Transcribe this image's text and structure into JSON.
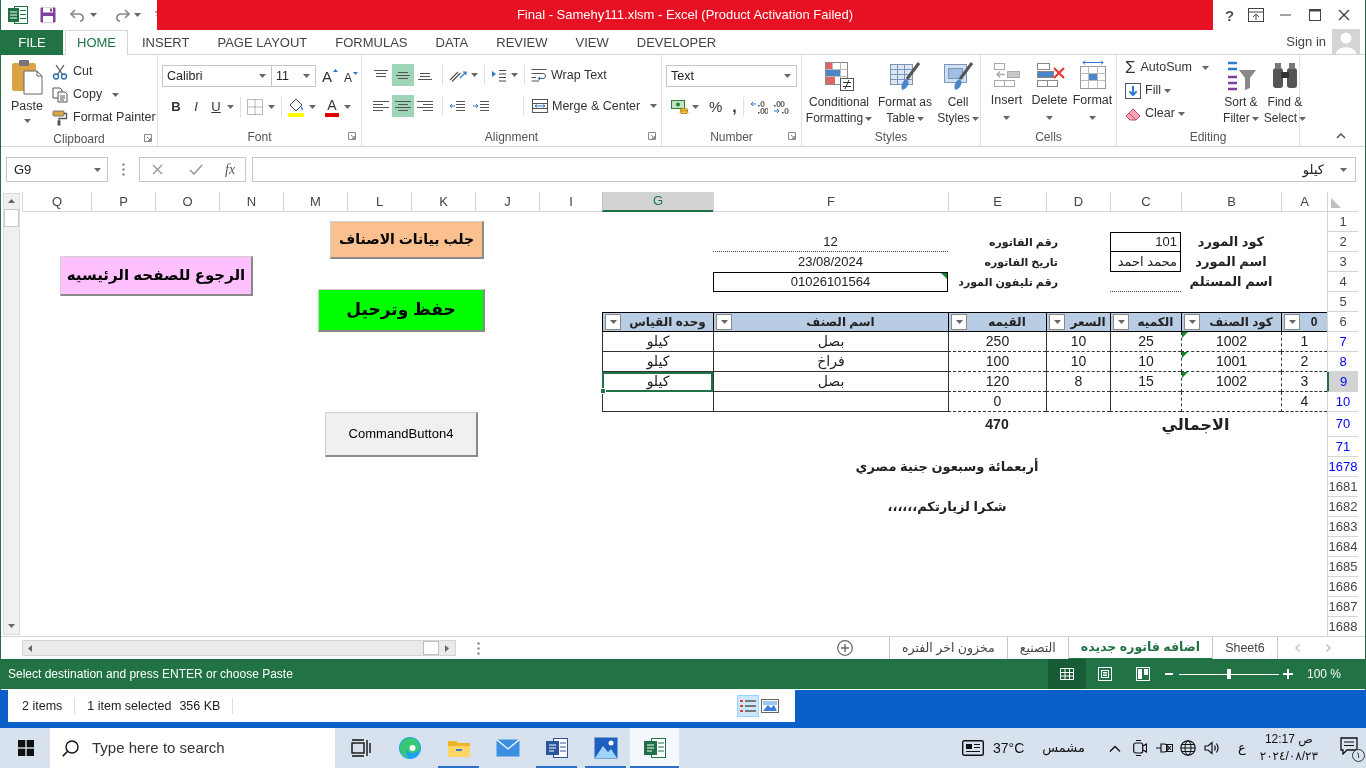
{
  "title_bar": {
    "title": "Final - Samehy111.xlsm - Excel (Product Activation Failed)",
    "help": "?"
  },
  "ribbon_tabs": {
    "file": {
      "label": "FILE",
      "kind": "file",
      "selected": false
    },
    "home": {
      "label": "HOME",
      "kind": "tab",
      "selected": true
    },
    "insert": {
      "label": "INSERT",
      "kind": "tab",
      "selected": false
    },
    "page_layout": {
      "label": "PAGE LAYOUT",
      "kind": "tab",
      "selected": false
    },
    "formulas": {
      "label": "FORMULAS",
      "kind": "tab",
      "selected": false
    },
    "data": {
      "label": "DATA",
      "kind": "tab",
      "selected": false
    },
    "review": {
      "label": "REVIEW",
      "kind": "tab",
      "selected": false
    },
    "view": {
      "label": "VIEW",
      "kind": "tab",
      "selected": false
    },
    "developer": {
      "label": "DEVELOPER",
      "kind": "tab",
      "selected": false
    }
  },
  "account": {
    "label": "Sign in"
  },
  "ribbon": {
    "clipboard": {
      "label": "Clipboard",
      "paste": "Paste",
      "cut": "Cut",
      "copy": "Copy",
      "format_painter": "Format Painter"
    },
    "font": {
      "label": "Font",
      "name": "Calibri",
      "size": "11",
      "grow": "A",
      "shrink": "A",
      "bold": "B",
      "italic": "I",
      "underline": "U",
      "font_color": "A"
    },
    "alignment": {
      "label": "Alignment",
      "vertical": [
        {
          "kind": "top",
          "selected": false
        },
        {
          "kind": "middle",
          "selected": true
        },
        {
          "kind": "bottom",
          "selected": false
        }
      ],
      "horizontal": [
        {
          "kind": "left",
          "selected": false
        },
        {
          "kind": "center",
          "selected": true
        },
        {
          "kind": "right",
          "selected": false
        }
      ],
      "wrap_text": "Wrap Text",
      "merge": "Merge & Center"
    },
    "number": {
      "label": "Number",
      "format": "Text",
      "percent": "%",
      "comma": ","
    },
    "styles": {
      "label": "Styles",
      "conditional_formatting": "Conditional Formatting",
      "format_as_table": "Format as Table",
      "cell_styles": "Cell Styles"
    },
    "cells": {
      "label": "Cells",
      "insert": "Insert",
      "delete": "Delete",
      "format": "Format"
    },
    "editing": {
      "label": "Editing",
      "sum_symbol": "Σ",
      "autosum": "AutoSum",
      "fill": "Fill",
      "clear": "Clear",
      "sort": "Sort & Filter",
      "find": "Find & Select"
    }
  },
  "formula_bar": {
    "name_box": "G9",
    "function_button": "fx",
    "value": "كيلو"
  },
  "sheet": {
    "columns": [
      {
        "label": "A",
        "selected": false
      },
      {
        "label": "B",
        "selected": false
      },
      {
        "label": "C",
        "selected": false
      },
      {
        "label": "D",
        "selected": false
      },
      {
        "label": "E",
        "selected": false
      },
      {
        "label": "F",
        "selected": false
      },
      {
        "label": "G",
        "selected": true
      },
      {
        "label": "I",
        "selected": false
      },
      {
        "label": "J",
        "selected": false
      },
      {
        "label": "K",
        "selected": false
      },
      {
        "label": "L",
        "selected": false
      },
      {
        "label": "M",
        "selected": false
      },
      {
        "label": "N",
        "selected": false
      },
      {
        "label": "O",
        "selected": false
      },
      {
        "label": "P",
        "selected": false
      },
      {
        "label": "Q",
        "selected": false
      }
    ],
    "rows": [
      {
        "label": "1",
        "filtered": false,
        "selected": false
      },
      {
        "label": "2",
        "filtered": false,
        "selected": false
      },
      {
        "label": "3",
        "filtered": false,
        "selected": false
      },
      {
        "label": "4",
        "filtered": false,
        "selected": false
      },
      {
        "label": "5",
        "filtered": false,
        "selected": false
      },
      {
        "label": "6",
        "filtered": false,
        "selected": false
      },
      {
        "label": "7",
        "filtered": true,
        "selected": false
      },
      {
        "label": "8",
        "filtered": true,
        "selected": false
      },
      {
        "label": "9",
        "filtered": true,
        "selected": true
      },
      {
        "label": "10",
        "filtered": true,
        "selected": false
      },
      {
        "label": "70",
        "filtered": true,
        "selected": false
      },
      {
        "label": "71",
        "filtered": true,
        "selected": false
      },
      {
        "label": "1678",
        "filtered": true,
        "selected": false
      },
      {
        "label": "1681",
        "filtered": false,
        "selected": false
      },
      {
        "label": "1682",
        "filtered": false,
        "selected": false
      },
      {
        "label": "1683",
        "filtered": false,
        "selected": false
      },
      {
        "label": "1684",
        "filtered": false,
        "selected": false
      },
      {
        "label": "1685",
        "filtered": false,
        "selected": false
      },
      {
        "label": "1686",
        "filtered": false,
        "selected": false
      },
      {
        "label": "1687",
        "filtered": false,
        "selected": false
      },
      {
        "label": "1688",
        "filtered": false,
        "selected": false
      }
    ],
    "supplier": [
      {
        "label": "كود المورد",
        "value": "101"
      },
      {
        "label": "اسم المورد",
        "value": "محمد احمد"
      },
      {
        "label": "اسم المستلم"
      }
    ],
    "invoice": [
      {
        "label": "رقم الفاتوره",
        "value": "12",
        "flag": false
      },
      {
        "label": "تاريخ الفاتوره",
        "value": "23/08/2024",
        "flag": false
      },
      {
        "label": "رقم تليفون المورد",
        "value": "01026101564",
        "flag": true
      }
    ],
    "table": {
      "columns": [
        "0",
        "كود الصنف",
        "الكميه",
        "السعر",
        "القيمه",
        "اسم الصنف",
        "وحده القياس"
      ],
      "rows": [
        {
          "cells": [
            "1",
            "1002",
            "25",
            "10",
            "250",
            "بصل",
            "كيلو"
          ],
          "flag": true
        },
        {
          "cells": [
            "2",
            "1001",
            "10",
            "10",
            "100",
            "فراخ",
            "كيلو"
          ],
          "flag": true
        },
        {
          "cells": [
            "3",
            "1002",
            "15",
            "8",
            "120",
            "بصل",
            "كيلو"
          ],
          "flag": true
        },
        {
          "cells": [
            "4",
            null,
            null,
            null,
            "0",
            null,
            null
          ],
          "flag": false
        }
      ]
    },
    "total": {
      "label": "الاجمالي",
      "value": "470"
    },
    "amount_in_words": "أربعمائة وسبعون جنية مصري",
    "thanks": "شكرا لزيارتكم،،،،،،",
    "buttons": [
      {
        "label": "جلب بيانات الاصناف",
        "color": "#fac090"
      },
      {
        "label": "الرجوع للصفحه الرئيسيه",
        "color": "#ffc0ff"
      },
      {
        "label": "حفظ وترحيل",
        "color": "#00ff00"
      },
      {
        "label": "CommandButton4",
        "color": "#f0f0f0"
      }
    ]
  },
  "sheet_tabs": [
    {
      "label": "Sheet6",
      "selected": false
    },
    {
      "label": "اضافه فاتوره جديده",
      "selected": true
    },
    {
      "label": "التصنيع",
      "selected": false
    },
    {
      "label": "مخزون اخر الفتره",
      "selected": false
    }
  ],
  "status_bar": {
    "message": "Select destination and press ENTER or choose Paste",
    "views": [
      {
        "kind": "normal",
        "selected": true
      },
      {
        "kind": "page_layout",
        "selected": false
      },
      {
        "kind": "page_break",
        "selected": false
      }
    ],
    "zoom": {
      "level": 0.5,
      "label": "100 %"
    }
  },
  "explorer": {
    "count": "2 items",
    "selection": "1 item selected",
    "size": "356 KB",
    "views": [
      {
        "kind": "details",
        "selected": true
      },
      {
        "kind": "large_icons",
        "selected": false
      }
    ]
  },
  "taskbar": {
    "search_placeholder": "Type here to search",
    "apps": [
      {
        "kind": "task_view",
        "running": false,
        "selected": false
      },
      {
        "kind": "browser",
        "running": false,
        "selected": false
      },
      {
        "kind": "file_explorer",
        "running": true,
        "selected": false
      },
      {
        "kind": "mail",
        "running": false,
        "selected": false
      },
      {
        "kind": "word",
        "running": true,
        "selected": false
      },
      {
        "kind": "photos",
        "running": true,
        "selected": false
      },
      {
        "kind": "spreadsheet",
        "running": true,
        "selected": true
      }
    ],
    "weather": {
      "temperature": "37°C",
      "condition": "مشمس"
    },
    "language": "ع",
    "time": "12:17 ص",
    "date": "٢٠٢٤/٠٨/٢٣",
    "notification_count": "١"
  }
}
